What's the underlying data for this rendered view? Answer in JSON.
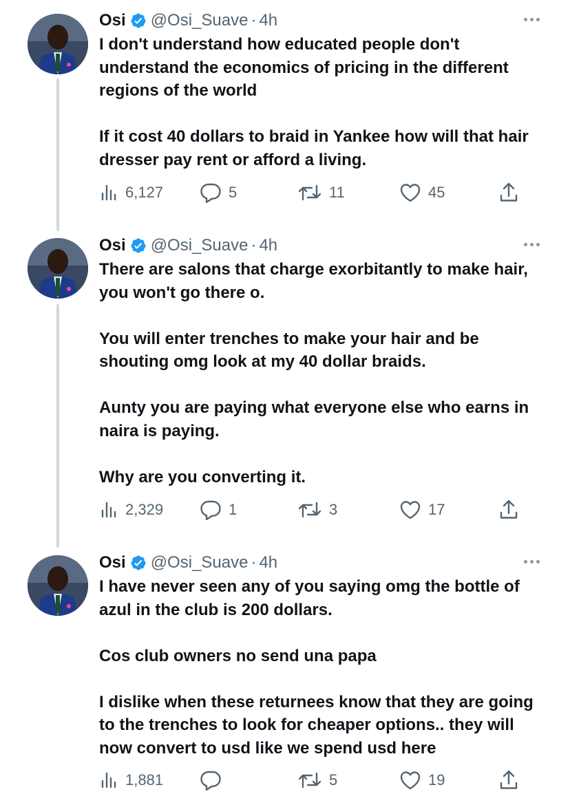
{
  "colors": {
    "text": "#0f1419",
    "secondary": "#536471",
    "verified": "#1d9bf0",
    "thread_line": "#cfd9de"
  },
  "tweets": [
    {
      "name": "Osi",
      "handle": "@Osi_Suave",
      "separator": "·",
      "time": "4h",
      "paragraphs": [
        "I don't understand how educated people don't understand the economics of pricing in the different regions of the world",
        "If it cost 40 dollars to braid in Yankee how will that hair dresser pay rent or afford a living."
      ],
      "views": "6,127",
      "replies": "5",
      "retweets": "11",
      "likes": "45"
    },
    {
      "name": "Osi",
      "handle": "@Osi_Suave",
      "separator": "·",
      "time": "4h",
      "paragraphs": [
        "There are salons that charge exorbitantly to make hair, you won't go there o.",
        "You will enter trenches to make your hair and be shouting omg look at my 40 dollar braids.",
        "Aunty you are paying what everyone else who earns in naira is paying.",
        "Why are you converting it."
      ],
      "views": "2,329",
      "replies": "1",
      "retweets": "3",
      "likes": "17"
    },
    {
      "name": "Osi",
      "handle": "@Osi_Suave",
      "separator": "·",
      "time": "4h",
      "paragraphs": [
        "I have never seen any of you saying omg the bottle of azul in the club is 200 dollars.",
        "Cos club owners no send una papa",
        "I dislike when these returnees know that they are going to the trenches to look for cheaper options.. they will now convert to usd like we spend usd here"
      ],
      "views": "1,881",
      "replies": "",
      "retweets": "5",
      "likes": "19"
    }
  ],
  "icons": {
    "verified": "verified-badge-icon",
    "more": "more-dots-icon",
    "views": "analytics-bars-icon",
    "reply": "speech-bubble-icon",
    "retweet": "retweet-arrows-icon",
    "like": "heart-icon",
    "share": "share-upload-icon"
  }
}
